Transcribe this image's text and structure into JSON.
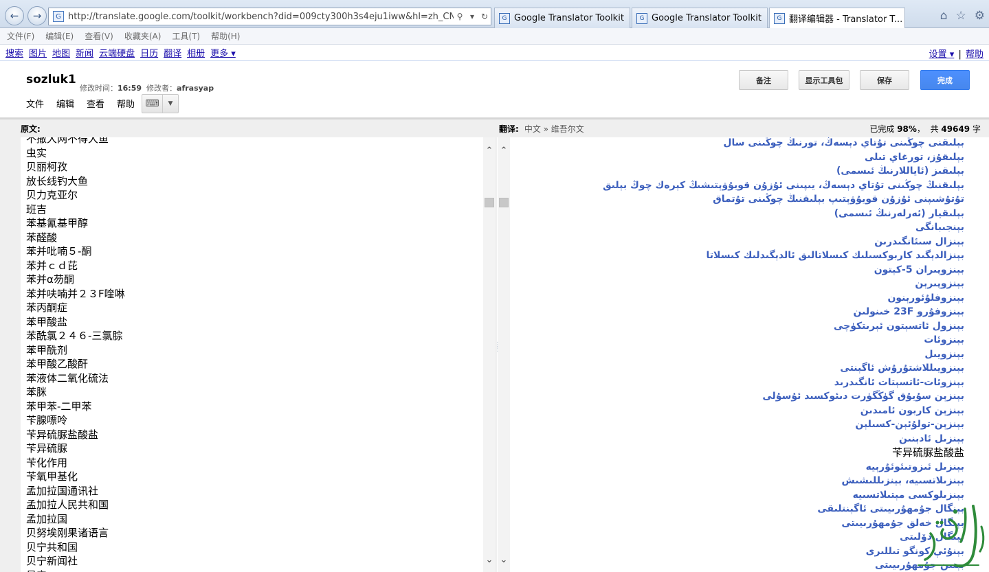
{
  "browser": {
    "url": "http://translate.google.com/toolkit/workbench?did=009cty300h3s4eju1iww&hl=zh_CN",
    "tabs": [
      {
        "label": "Google Translator Toolkit"
      },
      {
        "label": "Google Translator Toolkit"
      },
      {
        "label": "翻译编辑器 - Translator T..."
      }
    ],
    "menu": [
      "文件(F)",
      "编辑(E)",
      "查看(V)",
      "收藏夹(A)",
      "工具(T)",
      "帮助(H)"
    ]
  },
  "google_bar": {
    "links": [
      "搜索",
      "图片",
      "地图",
      "新闻",
      "云端硬盘",
      "日历",
      "翻译",
      "相册",
      "更多 ▾"
    ],
    "settings": "设置 ▾",
    "separator": "|",
    "help": "帮助"
  },
  "document": {
    "title": "sozluk1",
    "modified_label": "修改时间：",
    "modified_time": "16:59",
    "modifier_label": "修改者：",
    "modifier": "afrasyap",
    "menu": [
      "文件",
      "编辑",
      "查看",
      "帮助"
    ]
  },
  "buttons": {
    "comment": "备注",
    "show_toolkit": "显示工具包",
    "save": "保存",
    "done": "完成"
  },
  "source_pane": {
    "label": "原文:",
    "lines": [
      "不撒大网不得大鱼",
      "虫实",
      "贝丽柯孜",
      "放长线钓大鱼",
      "贝力克亚尔",
      "班吉",
      "苯基氰基甲醇",
      "苯醛酸",
      "苯并吡喃５-酮",
      "苯并ｃｄ芘",
      "苯并α芴酮",
      "苯并呋喃并２３F喹啉",
      "苯丙酮症",
      "苯甲酸盐",
      "苯酰氯２４６-三氯腙",
      "苯甲酰剂",
      "苯甲酸乙酸酐",
      "苯液体二氧化硫法",
      "苯脒",
      "苯甲苯-二甲苯",
      "苄腺嘌呤",
      "苄异硫脲盐酸盐",
      "苄异硫脲",
      "苄化作用",
      "苄氧甲基化",
      "孟加拉国通讯社",
      "孟加拉人民共和国",
      "孟加拉国",
      "贝努埃刚果诸语言",
      "贝宁共和国",
      "贝宁新闻社",
      "贝宁…"
    ]
  },
  "target_pane": {
    "label": "翻译:",
    "languages": "中文 » 维吾尔文",
    "completed_label": "已完成",
    "completed_percent": "98%",
    "total_label": "共",
    "total_words": "49649",
    "words_unit": "字",
    "lines": [
      {
        "text": "بېلىقنى چوڭىنى تۇتاي دېسەڭ، تورنىڭ چوڭىنى سال",
        "plain": false
      },
      {
        "text": "بېلىقۇز، تورغاي تىلى",
        "plain": false
      },
      {
        "text": "بېلىقىز (ئاياللارنىڭ ئىسمى)",
        "plain": false
      },
      {
        "text": "بېلىقنىڭ چوڭىنى تۇتاي دېسەڭ، يىپىنى ئۇزۇن قويۇۋېتىشىڭ كېرەك چوڭ بېلىق",
        "plain": false
      },
      {
        "text": "تۇتۇشىپنى ئۇزۇن قويۇۋېتىپ بېلىقنىڭ چوڭىنى تۇتماق",
        "plain": false
      },
      {
        "text": "بېلىقيار (ئەرلەرنىڭ ئىسمى)",
        "plain": false
      },
      {
        "text": "بېنجىبانگى",
        "plain": false
      },
      {
        "text": "بېنزال سىئانگىدرىن",
        "plain": false
      },
      {
        "text": "بېنزالدېگىد كاربوكسىلىك كىسلاتالىق ئالدېگىدلىك كىسلاتا",
        "plain": false
      },
      {
        "text": "بېنزوپىران 5-كېتون",
        "plain": false
      },
      {
        "text": "بېنزوپىرېن",
        "plain": false
      },
      {
        "text": "بېنزوفلۇئورېنون",
        "plain": false
      },
      {
        "text": "بېنزوفۇرو 23F خىنولىن",
        "plain": false
      },
      {
        "text": "بېنزول ئاتسېتون ئېرىتكۈچى",
        "plain": false
      },
      {
        "text": "بېنزوئات",
        "plain": false
      },
      {
        "text": "بېنزويىل",
        "plain": false
      },
      {
        "text": "بېنزويىللاشتۇرۇش ئاگېنتى",
        "plain": false
      },
      {
        "text": "بېنزوئات-ئاتسېتات ئانگىدرىد",
        "plain": false
      },
      {
        "text": "بېنزېن سۇيۇق گۈڭگۈرت دىئوكسىد ئۇسۇلى",
        "plain": false
      },
      {
        "text": "بېنزېن كاربون ئامىدىن",
        "plain": false
      },
      {
        "text": "بېنزېن-تولۇئېن-كسىلېن",
        "plain": false
      },
      {
        "text": "بېنزىل ئادېنىن",
        "plain": false
      },
      {
        "text": "苄异硫脲盐酸盐",
        "plain": true
      },
      {
        "text": "بېنزىل ئىزوتىئوئۇرېيە",
        "plain": false
      },
      {
        "text": "بېنزىلاتسىيە، بېنزىللىشىش",
        "plain": false
      },
      {
        "text": "بېنزىلوكسى مېتىلاتسىيە",
        "plain": false
      },
      {
        "text": "بېنگال جۇمھۇرىيىتى ئاگېنتلىقى",
        "plain": false
      },
      {
        "text": "بېنگال خەلق جۇمھۇرىيىتى",
        "plain": false
      },
      {
        "text": "بېنگال دۆلىتى",
        "plain": false
      },
      {
        "text": "بېنۇئې كونگو تىللىرى",
        "plain": false
      },
      {
        "text": "بېنىن جۇمھۇرىيىتى",
        "plain": false
      }
    ]
  },
  "watermark": {
    "text": "ئالتۇنى",
    "color": "#2e8b3a"
  }
}
